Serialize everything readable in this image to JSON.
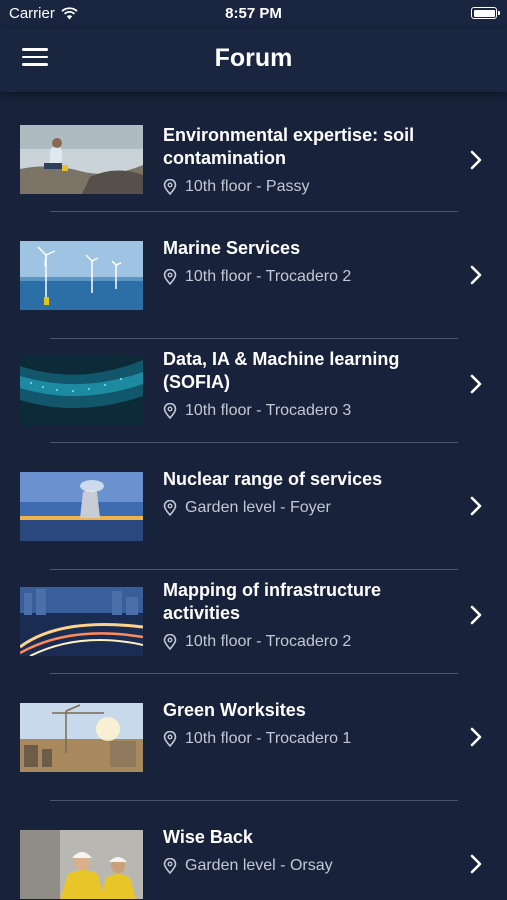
{
  "status_bar": {
    "carrier": "Carrier",
    "time": "8:57 PM"
  },
  "header": {
    "title": "Forum",
    "menu_icon": "hamburger-menu-icon"
  },
  "items": [
    {
      "title": "Environmental expertise: soil contamination",
      "location": "10th floor - Passy"
    },
    {
      "title": "Marine Services",
      "location": "10th floor - Trocadero 2"
    },
    {
      "title": "Data, IA & Machine learning (SOFIA)",
      "location": "10th floor - Trocadero 3"
    },
    {
      "title": "Nuclear range of services",
      "location": "Garden level - Foyer"
    },
    {
      "title": "Mapping of infrastructure activities",
      "location": "10th floor - Trocadero 2"
    },
    {
      "title": "Green Worksites",
      "location": "10th floor - Trocadero 1"
    },
    {
      "title": "Wise Back",
      "location": "Garden level - Orsay"
    }
  ],
  "colors": {
    "background": "#18223a",
    "navbar": "#1a2540",
    "secondary_text": "#c2c8d4",
    "divider": "#4a5572"
  }
}
